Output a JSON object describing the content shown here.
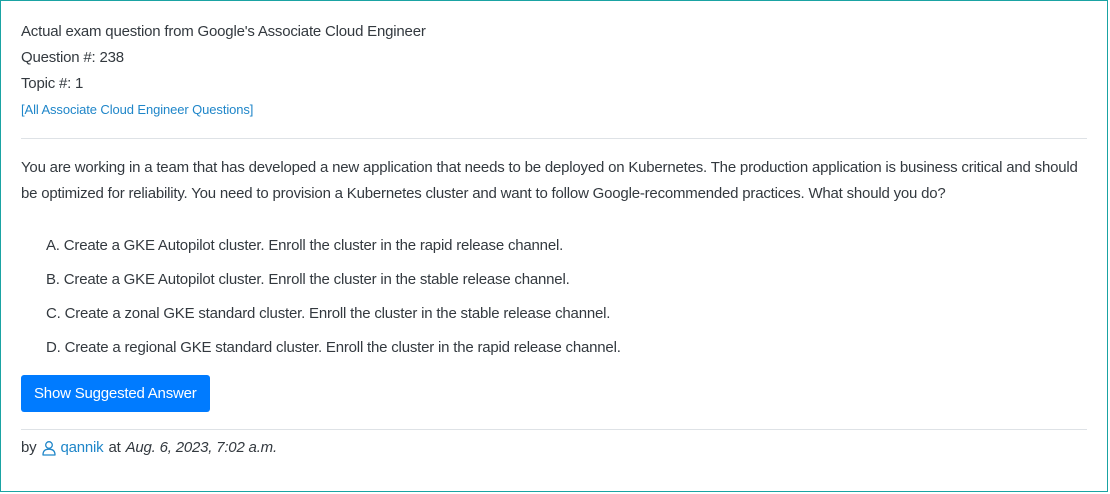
{
  "header": {
    "source_line": "Actual exam question from Google's Associate Cloud Engineer",
    "question_number": "Question #: 238",
    "topic_number": "Topic #: 1",
    "all_questions_link": "[All Associate Cloud Engineer Questions]"
  },
  "question": {
    "text": "You are working in a team that has developed a new application that needs to be deployed on Kubernetes. The production application is business critical and should be optimized for reliability. You need to provision a Kubernetes cluster and want to follow Google-recommended practices. What should you do?"
  },
  "choices": [
    {
      "letter": "A.",
      "text": "Create a GKE Autopilot cluster. Enroll the cluster in the rapid release channel."
    },
    {
      "letter": "B.",
      "text": "Create a GKE Autopilot cluster. Enroll the cluster in the stable release channel."
    },
    {
      "letter": "C.",
      "text": "Create a zonal GKE standard cluster. Enroll the cluster in the stable release channel."
    },
    {
      "letter": "D.",
      "text": "Create a regional GKE standard cluster. Enroll the cluster in the rapid release channel."
    }
  ],
  "actions": {
    "show_answer_label": "Show Suggested Answer"
  },
  "footer": {
    "by_label": "by",
    "user_icon": "user-icon",
    "username": "qannik",
    "at_label": "at",
    "timestamp": "Aug. 6, 2023, 7:02 a.m."
  },
  "colors": {
    "border": "#1aa3a3",
    "link": "#1f86c9",
    "button_bg": "#007bff",
    "text": "#33393f"
  }
}
